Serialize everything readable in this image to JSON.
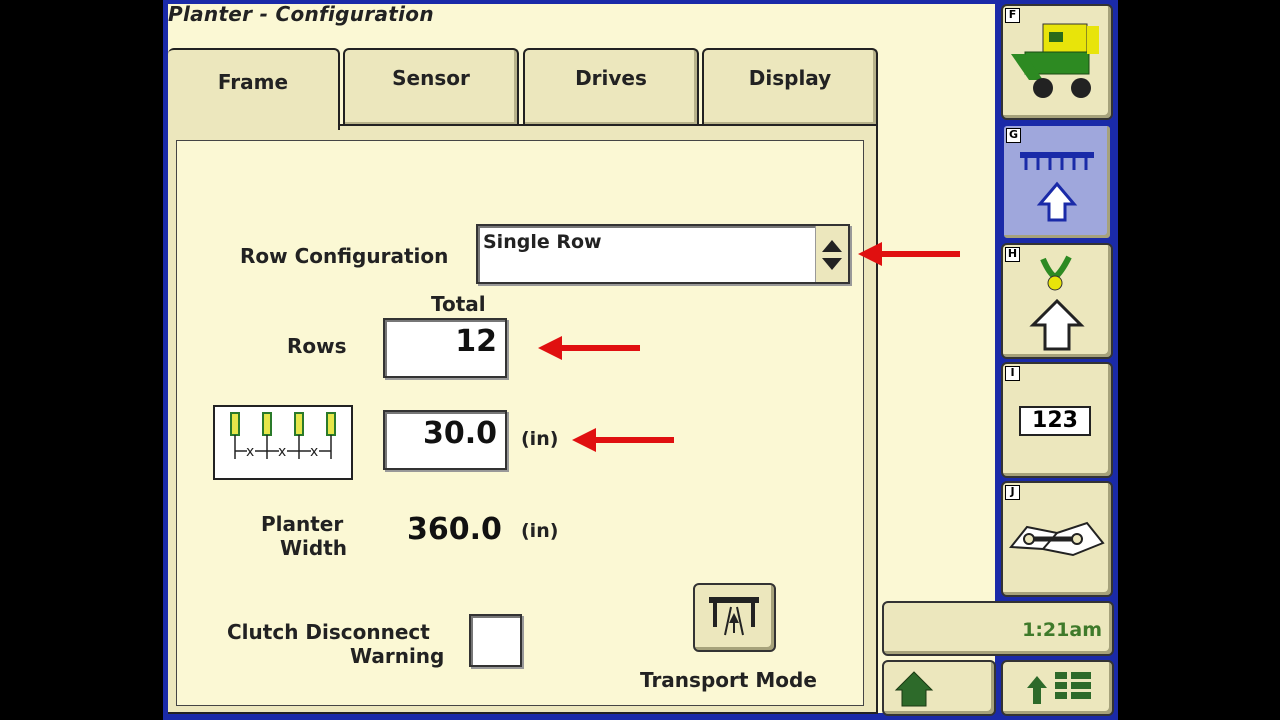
{
  "header": {
    "title": "Planter - Configuration"
  },
  "tabs": [
    {
      "label": "Frame"
    },
    {
      "label": "Sensor"
    },
    {
      "label": "Drives"
    },
    {
      "label": "Display"
    }
  ],
  "form": {
    "row_config_label": "Row Configuration",
    "row_config_value": "Single Row",
    "total_label": "Total",
    "rows_label": "Rows",
    "rows_value": "12",
    "spacing_value": "30.0",
    "spacing_unit": "(in)",
    "planter_width_label_1": "Planter",
    "planter_width_label_2": "Width",
    "planter_width_value": "360.0",
    "planter_width_unit": "(in)",
    "clutch_label_1": "Clutch Disconnect",
    "clutch_label_2": "Warning",
    "transport_label": "Transport Mode"
  },
  "sidebar": {
    "keys": [
      "F",
      "G",
      "H",
      "I",
      "J"
    ],
    "icons": [
      "planter-icon",
      "row-unit-up-icon",
      "seed-up-icon",
      "numeric-123-icon",
      "manual-wrench-icon"
    ],
    "counter_text": "123"
  },
  "status": {
    "time": "1:21am"
  },
  "colors": {
    "accent": "#1a2aa8",
    "panel": "#fbf8d4",
    "arrow": "#e01010",
    "time_text": "#3f7a2a"
  }
}
